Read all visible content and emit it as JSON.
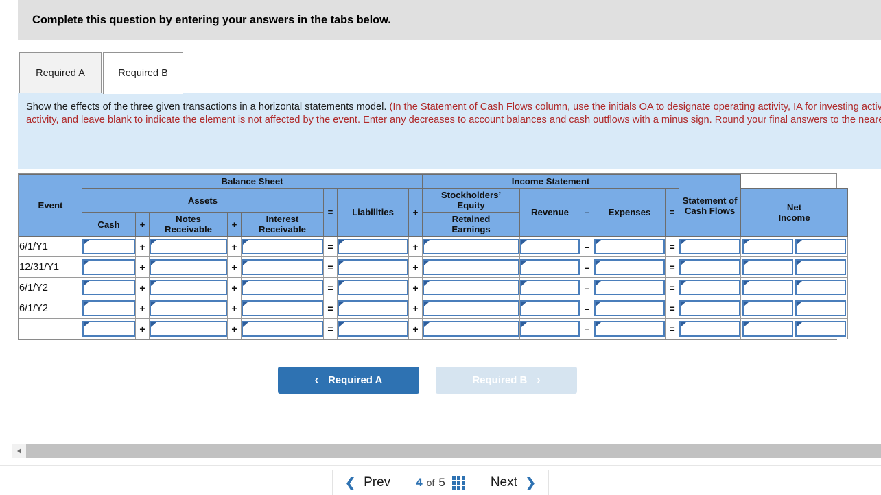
{
  "banner": {
    "text": "Complete this question by entering your answers in the tabs below."
  },
  "tabs": [
    {
      "label": "Required A",
      "active": false
    },
    {
      "label": "Required B",
      "active": true
    }
  ],
  "instructions": {
    "lead": "Show the effects of the three given transactions in a horizontal statements model. ",
    "red": "(In the Statement of Cash Flows column, use the initials OA to designate operating activity, IA for investing activity, FA for financing activity, and leave blank to indicate the element is not affected by the event. Enter any decreases to account balances and cash outflows with a minus sign. Round your final answers to the nearest whole dollar.)"
  },
  "table": {
    "group_headers": {
      "event": "Event",
      "balance_sheet": "Balance Sheet",
      "income_statement": "Income Statement",
      "cash_flows": "Statement of\nCash Flows"
    },
    "sub_headers": {
      "assets": "Assets",
      "liabilities": "Liabilities",
      "stockholders_equity": "Stockholders’\nEquity",
      "retained_earnings": "Retained\nEarnings"
    },
    "columns": {
      "cash": "Cash",
      "notes_receivable": "Notes\nReceivable",
      "interest_receivable": "Interest\nReceivable",
      "revenue": "Revenue",
      "expenses": "Expenses",
      "net_income": "Net\nIncome"
    },
    "operators": {
      "plus": "+",
      "equals": "=",
      "minus": "–"
    },
    "rows": [
      {
        "event": "6/1/Y1",
        "cash": "",
        "notes_receivable": "",
        "interest_receivable": "",
        "liabilities": "",
        "retained_earnings": "",
        "revenue": "",
        "expenses": "",
        "net_income": "",
        "cash_flow_amount": "",
        "cash_flow_activity": ""
      },
      {
        "event": "12/31/Y1",
        "cash": "",
        "notes_receivable": "",
        "interest_receivable": "",
        "liabilities": "",
        "retained_earnings": "",
        "revenue": "",
        "expenses": "",
        "net_income": "",
        "cash_flow_amount": "",
        "cash_flow_activity": ""
      },
      {
        "event": "6/1/Y2",
        "cash": "",
        "notes_receivable": "",
        "interest_receivable": "",
        "liabilities": "",
        "retained_earnings": "",
        "revenue": "",
        "expenses": "",
        "net_income": "",
        "cash_flow_amount": "",
        "cash_flow_activity": ""
      },
      {
        "event": "6/1/Y2",
        "cash": "",
        "notes_receivable": "",
        "interest_receivable": "",
        "liabilities": "",
        "retained_earnings": "",
        "revenue": "",
        "expenses": "",
        "net_income": "",
        "cash_flow_amount": "",
        "cash_flow_activity": ""
      },
      {
        "event": "",
        "cash": "",
        "notes_receivable": "",
        "interest_receivable": "",
        "liabilities": "",
        "retained_earnings": "",
        "revenue": "",
        "expenses": "",
        "net_income": "",
        "cash_flow_amount": "",
        "cash_flow_activity": ""
      }
    ]
  },
  "req_buttons": {
    "prev": {
      "label": "Required A",
      "chevron": "‹",
      "state": "enabled"
    },
    "next": {
      "label": "Required B",
      "chevron": "›",
      "state": "disabled"
    }
  },
  "pager": {
    "prev_label": "Prev",
    "prev_chevron": "❮",
    "current": "4",
    "of": "of",
    "total": "5",
    "grid_icon": "grid-icon",
    "next_label": "Next",
    "next_chevron": "❯"
  },
  "scrollbar": {
    "left_arrow_icon": "caret-left-icon"
  },
  "colors": {
    "header_blue": "#79ACE6",
    "instruction_bg": "#D9EAF8",
    "instruction_red": "#B02A2A",
    "banner_gray": "#E0E0E0",
    "primary_button": "#2E72B2",
    "disabled_button": "#D6E4F0",
    "input_border": "#4A7EBB"
  }
}
